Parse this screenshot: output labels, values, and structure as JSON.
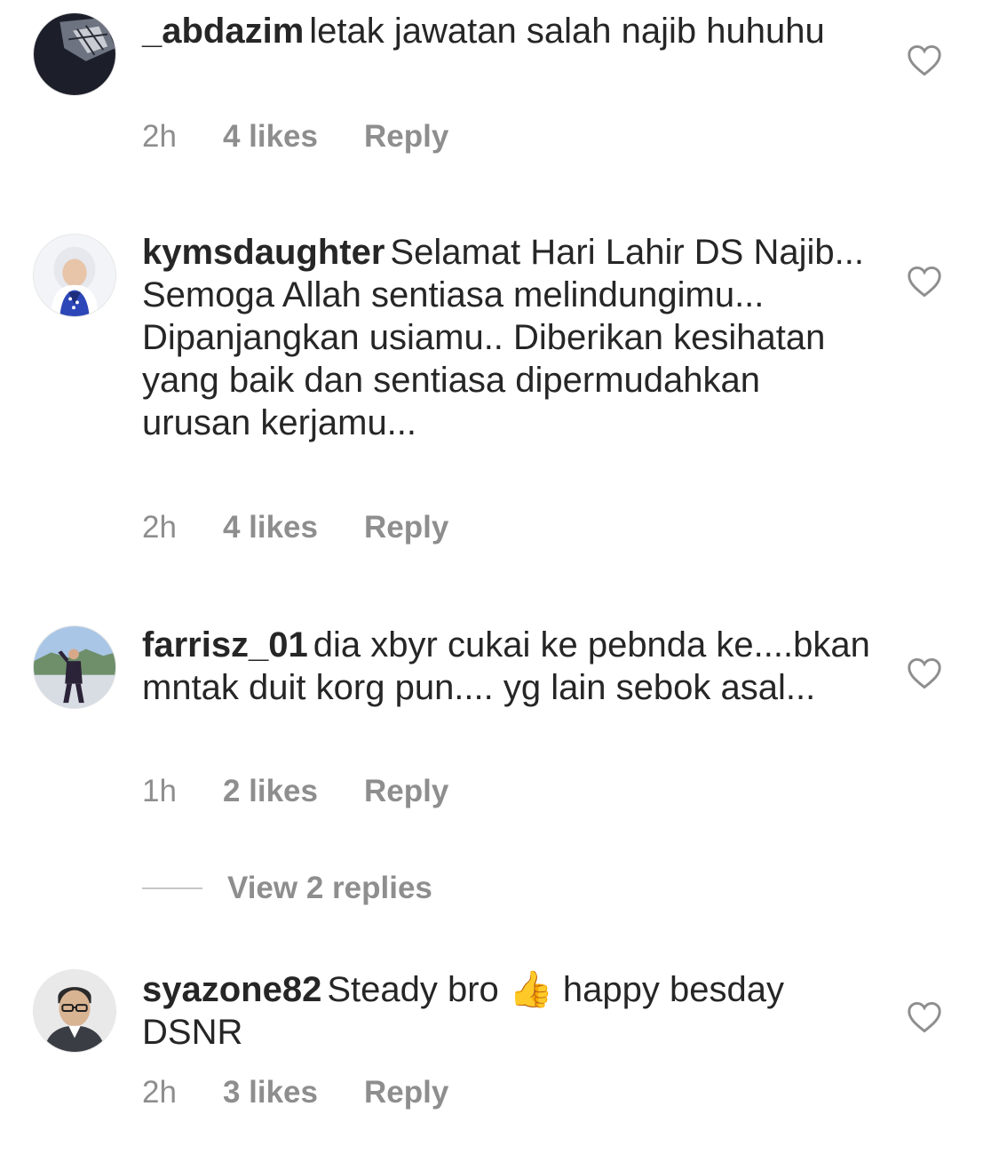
{
  "comments": [
    {
      "username": "_abdazim",
      "text": "letak jawatan salah najib huhuhu",
      "time": "2h",
      "likes": "4 likes",
      "reply_label": "Reply",
      "like_icon": "heart-outline-icon"
    },
    {
      "username": "kymsdaughter",
      "text": "Selamat Hari Lahir DS Najib... Semoga Allah sentiasa melindungimu... Dipanjangkan usiamu.. Diberikan kesihatan yang baik dan sentiasa dipermudahkan urusan kerjamu...",
      "time": "2h",
      "likes": "4 likes",
      "reply_label": "Reply",
      "like_icon": "heart-outline-icon"
    },
    {
      "username": "farrisz_01",
      "text": "dia xbyr  cukai ke pebnda ke....bkan mntak duit korg pun.... yg lain sebok asal...",
      "time": "1h",
      "likes": "2 likes",
      "reply_label": "Reply",
      "view_replies": "View 2 replies",
      "like_icon": "heart-outline-icon"
    },
    {
      "username": "syazone82",
      "text_before": "Steady bro",
      "emoji": "👍",
      "text_after": "happy besday DSNR",
      "time": "2h",
      "likes": "3 likes",
      "reply_label": "Reply",
      "like_icon": "heart-outline-icon"
    }
  ],
  "colors": {
    "text": "#262626",
    "meta": "#8e8e8e",
    "divider": "#c7c7c7"
  }
}
